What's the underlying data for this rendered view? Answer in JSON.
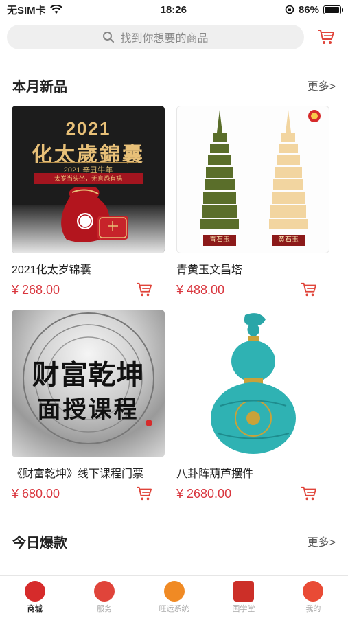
{
  "status": {
    "carrier": "无SIM卡",
    "time": "18:26",
    "battery": "86%"
  },
  "search": {
    "placeholder": "找到你想要的商品"
  },
  "sections": [
    {
      "title": "本月新品",
      "more": "更多>"
    },
    {
      "title": "今日爆款",
      "more": "更多>"
    }
  ],
  "products": [
    {
      "name": "2021化太岁锦囊",
      "price": "¥ 268.00",
      "img_title": "2021",
      "img_subtitle": "化太歲錦囊",
      "img_line": "2021 辛丑牛年",
      "img_bar": "太岁当头坐，无喜恐有祸"
    },
    {
      "name": "青黄玉文昌塔",
      "price": "¥ 488.00",
      "tag_left": "青石玉",
      "tag_right": "黄石玉"
    },
    {
      "name": "《财富乾坤》线下课程门票",
      "price": "¥ 680.00",
      "img_line1": "财富乾坤",
      "img_line2": "面授课程"
    },
    {
      "name": "八卦阵葫芦摆件",
      "price": "¥ 2680.00"
    }
  ],
  "tabs": [
    {
      "label": "商城",
      "color": "#d62b2b"
    },
    {
      "label": "服务",
      "color": "#e0443a"
    },
    {
      "label": "旺运系统",
      "color": "#f08a24"
    },
    {
      "label": "国学堂",
      "color": "#cc2f28"
    },
    {
      "label": "我的",
      "color": "#e94b35"
    }
  ],
  "colors": {
    "accent": "#d9363e"
  }
}
